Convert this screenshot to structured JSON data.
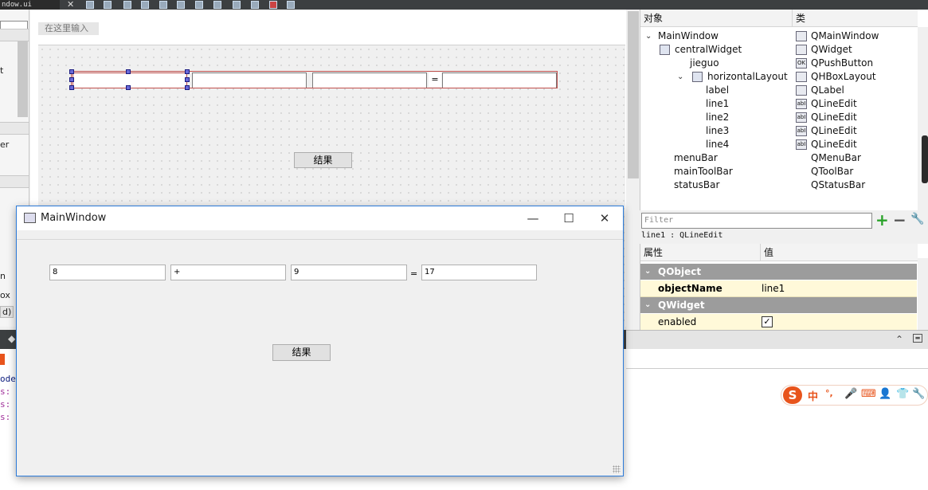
{
  "file_tab": "ndow.ui",
  "designer": {
    "type_here": "在这里输入",
    "result_button": "结果",
    "equals": "="
  },
  "left_panel": {
    "frag1": "t",
    "frag2": "er",
    "frag3": "n",
    "frag4": "ox",
    "frag5": "d)"
  },
  "window": {
    "title": "MainWindow",
    "line1": "8",
    "line2": "+",
    "line3": "9",
    "equals": "=",
    "line4": "17",
    "result_button": "结果",
    "minimize": "—",
    "maximize": "☐",
    "close": "✕"
  },
  "object_inspector": {
    "col_object": "对象",
    "col_class": "类",
    "rows": [
      {
        "name": "MainWindow",
        "cls": "QMainWindow",
        "icon": "mainwindow-icon"
      },
      {
        "name": "centralWidget",
        "cls": "QWidget",
        "icon": "widget-icon"
      },
      {
        "name": "jieguo",
        "cls": "QPushButton",
        "icon": "pushbutton-icon"
      },
      {
        "name": "horizontalLayout",
        "cls": "QHBoxLayout",
        "icon": "hboxlayout-icon"
      },
      {
        "name": "label",
        "cls": "QLabel",
        "icon": "label-icon"
      },
      {
        "name": "line1",
        "cls": "QLineEdit",
        "icon": "lineedit-icon"
      },
      {
        "name": "line2",
        "cls": "QLineEdit",
        "icon": "lineedit-icon"
      },
      {
        "name": "line3",
        "cls": "QLineEdit",
        "icon": "lineedit-icon"
      },
      {
        "name": "line4",
        "cls": "QLineEdit",
        "icon": "lineedit-icon"
      },
      {
        "name": "menuBar",
        "cls": "QMenuBar",
        "icon": ""
      },
      {
        "name": "mainToolBar",
        "cls": "QToolBar",
        "icon": ""
      },
      {
        "name": "statusBar",
        "cls": "QStatusBar",
        "icon": ""
      }
    ]
  },
  "filter": {
    "placeholder": "Filter",
    "current_object": "line1 : QLineEdit"
  },
  "property_editor": {
    "col_property": "属性",
    "col_value": "值",
    "section1": "QObject",
    "object_name_label": "objectName",
    "object_name_value": "line1",
    "section2": "QWidget",
    "enabled_label": "enabled",
    "enabled_value": "✓"
  },
  "code_panel": {
    "line1": "ode",
    "line2": "s:",
    "line3": "s:",
    "line4": "s:"
  },
  "ime": {
    "logo": "S",
    "mode": "中",
    "punct": "°,"
  }
}
